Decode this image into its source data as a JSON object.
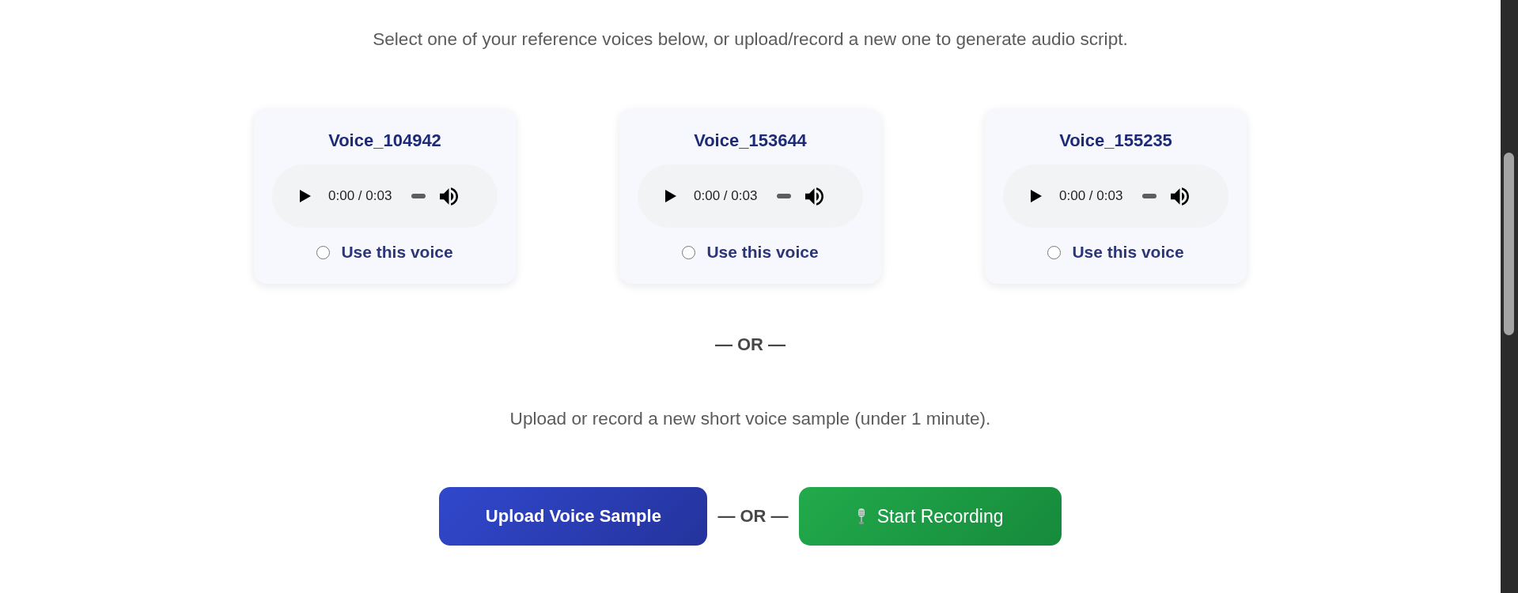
{
  "intro": "Select one of your reference voices below, or upload/record a new one to generate audio script.",
  "voices": [
    {
      "name": "Voice_104942",
      "player": {
        "time": "0:00 / 0:03"
      },
      "option": {
        "label": "Use this voice",
        "selected": false
      }
    },
    {
      "name": "Voice_153644",
      "player": {
        "time": "0:00 / 0:03"
      },
      "option": {
        "label": "Use this voice",
        "selected": false
      }
    },
    {
      "name": "Voice_155235",
      "player": {
        "time": "0:00 / 0:03"
      },
      "option": {
        "label": "Use this voice",
        "selected": false
      }
    }
  ],
  "separator": "— OR —",
  "prompt": "Upload or record a new short voice sample (under 1 minute).",
  "actions": [
    {
      "kind": "upload",
      "label": "Upload Voice Sample"
    },
    {
      "kind": "separator",
      "label": "— OR —"
    },
    {
      "kind": "record",
      "label": "Start Recording"
    }
  ]
}
